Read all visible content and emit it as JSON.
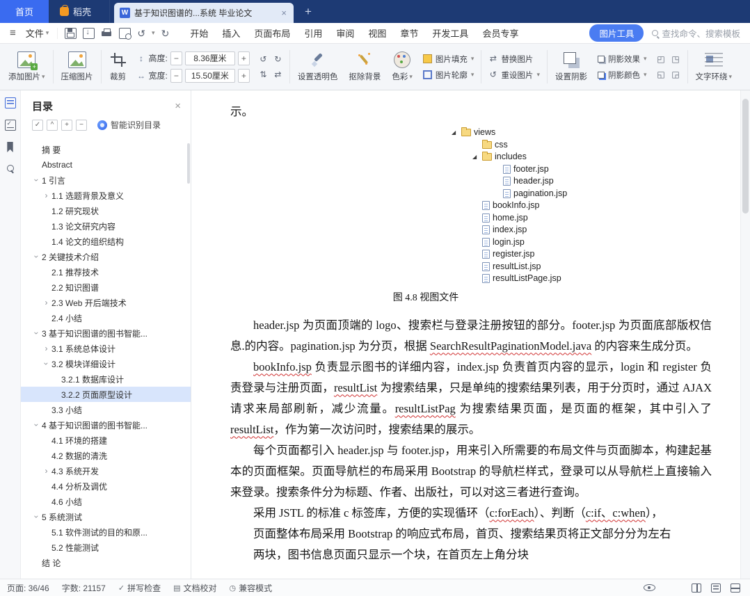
{
  "titlebar": {
    "home": "首页",
    "docer": "稻壳",
    "doc_title": "基于知识图谱的...系统 毕业论文",
    "new_tab": "+"
  },
  "menubar": {
    "file": "文件",
    "items": [
      "开始",
      "插入",
      "页面布局",
      "引用",
      "审阅",
      "视图",
      "章节",
      "开发工具",
      "会员专享"
    ],
    "picture_tools": "图片工具",
    "search": "查找命令、搜索模板"
  },
  "ribbon": {
    "add_picture": "添加图片",
    "compress_picture": "压缩图片",
    "crop": "裁剪",
    "height_label": "高度:",
    "height_value": "8.36厘米",
    "width_label": "宽度:",
    "width_value": "15.50厘米",
    "set_transparent": "设置透明色",
    "remove_background": "抠除背景",
    "color": "色彩",
    "picture_fill": "图片填充",
    "picture_outline": "图片轮廓",
    "replace_picture": "替换图片",
    "reset_picture": "重设图片",
    "set_shadow": "设置阴影",
    "shadow_effect": "阴影效果",
    "shadow_color": "阴影颜色",
    "text_wrap": "文字环绕"
  },
  "icons": {
    "hamburger": "≡",
    "caret-down": "▾",
    "close": "×",
    "undo": "↺",
    "redo": "↻",
    "minus": "−",
    "plus": "+",
    "height-dim": "↕",
    "width-dim": "↔",
    "rotate-left": "↺",
    "rotate-right": "↻",
    "flip-v": "⇅",
    "flip-h": "⇄",
    "replace": "⇄",
    "reset": "↺",
    "check": "✓",
    "collapse": "^",
    "proof": "▤",
    "compat": "◷",
    "shadow-presets": [
      "◰",
      "◳",
      "◱",
      "◲"
    ]
  },
  "sidebar": {
    "title": "目录",
    "smart_toc": "智能识别目录",
    "items": [
      {
        "label": "摘  要",
        "level": 0,
        "arrow": "none"
      },
      {
        "label": "Abstract",
        "level": 0,
        "arrow": "none"
      },
      {
        "label": "1 引言",
        "level": 0,
        "arrow": "down"
      },
      {
        "label": "1.1 选题背景及意义",
        "level": 1,
        "arrow": "right"
      },
      {
        "label": "1.2 研究现状",
        "level": 1,
        "arrow": "none"
      },
      {
        "label": "1.3 论文研究内容",
        "level": 1,
        "arrow": "none"
      },
      {
        "label": "1.4 论文的组织结构",
        "level": 1,
        "arrow": "none"
      },
      {
        "label": "2 关键技术介绍",
        "level": 0,
        "arrow": "down"
      },
      {
        "label": "2.1 推荐技术",
        "level": 1,
        "arrow": "none"
      },
      {
        "label": "2.2 知识图谱",
        "level": 1,
        "arrow": "none"
      },
      {
        "label": "2.3 Web 开后端技术",
        "level": 1,
        "arrow": "right"
      },
      {
        "label": "2.4 小结",
        "level": 1,
        "arrow": "none"
      },
      {
        "label": "3 基于知识图谱的图书智能...",
        "level": 0,
        "arrow": "down"
      },
      {
        "label": "3.1 系统总体设计",
        "level": 1,
        "arrow": "right"
      },
      {
        "label": "3.2 模块详细设计",
        "level": 1,
        "arrow": "down"
      },
      {
        "label": "3.2.1 数据库设计",
        "level": 2,
        "arrow": "none"
      },
      {
        "label": "3.2.2 页面原型设计",
        "level": 2,
        "arrow": "none",
        "selected": true
      },
      {
        "label": "3.3 小结",
        "level": 1,
        "arrow": "none"
      },
      {
        "label": "4 基于知识图谱的图书智能...",
        "level": 0,
        "arrow": "down"
      },
      {
        "label": "4.1 环境的搭建",
        "level": 1,
        "arrow": "none"
      },
      {
        "label": "4.2 数据的清洗",
        "level": 1,
        "arrow": "none"
      },
      {
        "label": "4.3 系统开发",
        "level": 1,
        "arrow": "right"
      },
      {
        "label": "4.4 分析及调优",
        "level": 1,
        "arrow": "none"
      },
      {
        "label": "4.6 小结",
        "level": 1,
        "arrow": "none"
      },
      {
        "label": "5 系统测试",
        "level": 0,
        "arrow": "down"
      },
      {
        "label": "5.1 软件测试的目的和原...",
        "level": 1,
        "arrow": "none"
      },
      {
        "label": "5.2 性能测试",
        "level": 1,
        "arrow": "none"
      },
      {
        "label": "结  论",
        "level": 0,
        "arrow": "none"
      }
    ]
  },
  "document": {
    "top_line": "示。",
    "tree": [
      {
        "name": "views",
        "icon": "folder",
        "indent": 0,
        "arrow": true
      },
      {
        "name": "css",
        "icon": "folder",
        "indent": 1,
        "arrow": false
      },
      {
        "name": "includes",
        "icon": "folder",
        "indent": 1,
        "arrow": true
      },
      {
        "name": "footer.jsp",
        "icon": "file",
        "indent": 2,
        "arrow": false
      },
      {
        "name": "header.jsp",
        "icon": "file",
        "indent": 2,
        "arrow": false
      },
      {
        "name": "pagination.jsp",
        "icon": "file",
        "indent": 2,
        "arrow": false
      },
      {
        "name": "bookInfo.jsp",
        "icon": "file",
        "indent": 1,
        "arrow": false
      },
      {
        "name": "home.jsp",
        "icon": "file",
        "indent": 1,
        "arrow": false
      },
      {
        "name": "index.jsp",
        "icon": "file",
        "indent": 1,
        "arrow": false
      },
      {
        "name": "login.jsp",
        "icon": "file",
        "indent": 1,
        "arrow": false
      },
      {
        "name": "register.jsp",
        "icon": "file",
        "indent": 1,
        "arrow": false
      },
      {
        "name": "resultList.jsp",
        "icon": "file",
        "indent": 1,
        "arrow": false
      },
      {
        "name": "resultListPage.jsp",
        "icon": "file",
        "indent": 1,
        "arrow": false
      }
    ],
    "caption": "图 4.8 视图文件",
    "paragraphs": [
      [
        {
          "text": "header.jsp 为页面顶端的 logo、搜索栏与登录注册按钮的部分。footer.jsp 为页面底部版权信息.的内容。pagination.jsp 为分页，根据 "
        },
        {
          "text": "SearchResultPaginationModel.java",
          "wavy": true
        },
        {
          "text": " 的内容来生成分页。"
        }
      ],
      [
        {
          "text": "bookInfo.jsp",
          "wavy": true
        },
        {
          "text": " 负责显示图书的详细内容，index.jsp 负责首页内容的显示，login 和 register 负责登录与注册页面，"
        },
        {
          "text": "resultList",
          "wavy": true
        },
        {
          "text": " 为搜索结果，只是单纯的搜索结果列表，用于分页时，通过 AJAX 请求来局部刷新，减少流量。"
        },
        {
          "text": "resultListPag",
          "wavy": true
        },
        {
          "text": " 为搜索结果页面，是页面的框架，其中引入了 "
        },
        {
          "text": "resultList",
          "wavy": true
        },
        {
          "text": "，作为第一次访问时，搜索结果的展示。"
        }
      ],
      [
        {
          "text": "每个页面都引入 header.jsp 与 footer.jsp，用来引入所需要的布局文件与页面脚本，构建起基本的页面框架。页面导航栏的布局采用 Bootstrap 的导航栏样式，登录可以从导航栏上直接输入来登录。搜索条件分为标题、作者、出版社，可以对这三者进行查询。"
        }
      ],
      [
        {
          "text": "采用 JSTL 的标准 c 标签库，方便的实现循环（"
        },
        {
          "text": "c:forEach",
          "wavy": true
        },
        {
          "text": "）、判断（"
        },
        {
          "text": "c:if、c:when",
          "wavy": true
        },
        {
          "text": "），"
        }
      ],
      [
        {
          "text": "页面整体布局采用 Bootstrap 的响应式布局，首页、搜索结果页将正文部分分为左右"
        }
      ],
      [
        {
          "text": "两块，图书信息页面只显示一个块，在首页左上角分块"
        }
      ]
    ]
  },
  "statusbar": {
    "page": "页面: 36/46",
    "words": "字数: 21157",
    "spell_check": "拼写检查",
    "doc_proof": "文档校对",
    "compat_mode": "兼容模式"
  }
}
